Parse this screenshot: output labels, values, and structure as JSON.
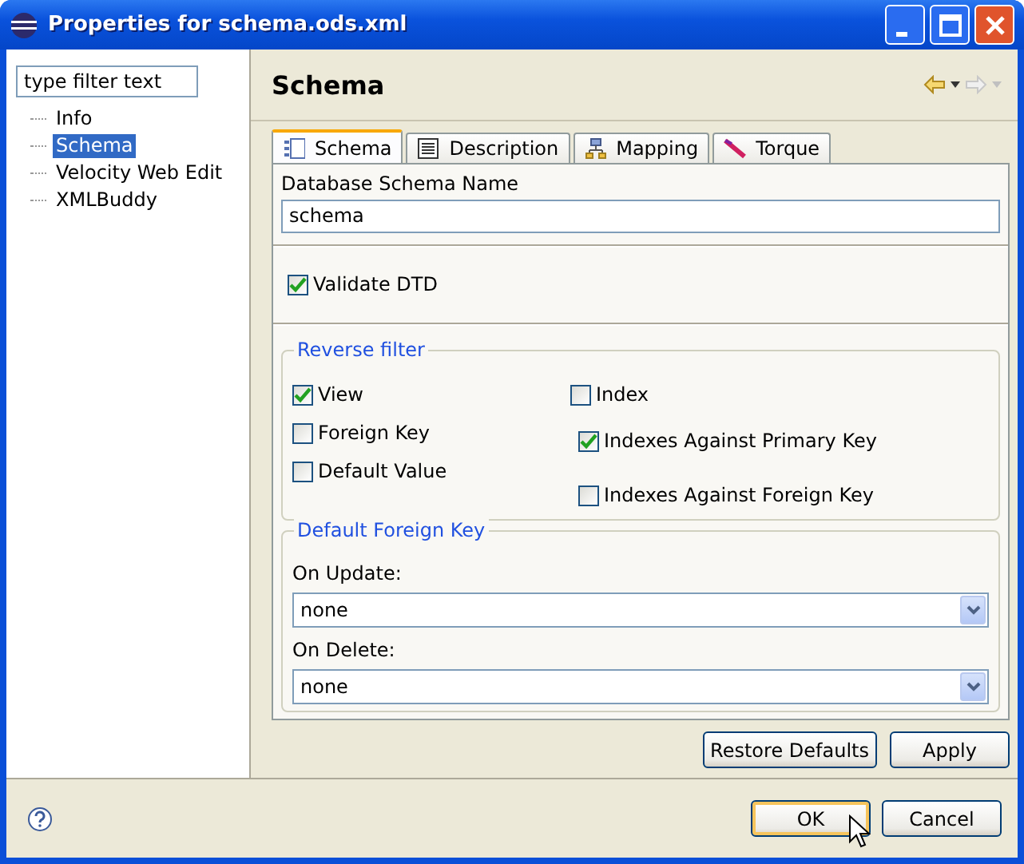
{
  "window": {
    "title": "Properties for schema.ods.xml"
  },
  "filter": {
    "placeholder": "type filter text"
  },
  "tree": [
    {
      "label": "Info",
      "selected": false
    },
    {
      "label": "Schema",
      "selected": true
    },
    {
      "label": "Velocity Web Edit",
      "selected": false
    },
    {
      "label": "XMLBuddy",
      "selected": false
    }
  ],
  "page": {
    "title": "Schema"
  },
  "tabs": [
    {
      "label": "Schema",
      "selected": true
    },
    {
      "label": "Description",
      "selected": false
    },
    {
      "label": "Mapping",
      "selected": false
    },
    {
      "label": "Torque",
      "selected": false
    }
  ],
  "schema_name": {
    "label": "Database Schema Name",
    "value": "schema"
  },
  "validate_dtd": {
    "label": "Validate DTD",
    "checked": true
  },
  "reverse_filter": {
    "title": "Reverse filter",
    "left": [
      {
        "label": "View",
        "checked": true
      },
      {
        "label": "Foreign Key",
        "checked": false
      },
      {
        "label": "Default Value",
        "checked": false
      }
    ],
    "right": [
      {
        "label": "Index",
        "checked": false
      },
      {
        "label": "Indexes Against Primary Key",
        "checked": true
      },
      {
        "label": "Indexes Against Foreign Key",
        "checked": false
      }
    ]
  },
  "default_foreign_key": {
    "title": "Default Foreign Key",
    "fields": [
      {
        "label": "On Update:",
        "value": "none"
      },
      {
        "label": "On Delete:",
        "value": "none"
      }
    ]
  },
  "page_buttons": [
    "Restore Defaults",
    "Apply"
  ],
  "dialog_buttons": [
    {
      "label": "OK",
      "default": true
    },
    {
      "label": "Cancel",
      "default": false
    }
  ]
}
